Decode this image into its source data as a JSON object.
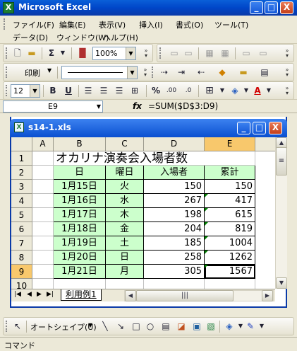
{
  "window": {
    "app_icon": "X",
    "title": "Microsoft Excel",
    "minimize": "_",
    "maximize": "□",
    "close": "X"
  },
  "menu": {
    "row1": [
      "ファイル(F)",
      "編集(E)",
      "表示(V)",
      "挿入(I)",
      "書式(O)",
      "ツール(T)"
    ],
    "row2": [
      "データ(D)",
      "ウィンドウ(W)",
      "ヘルプ(H)"
    ]
  },
  "toolbar_standard": {
    "zoom": "100%"
  },
  "toolbar_drawing_top": {
    "print_label": "印刷"
  },
  "toolbar_format": {
    "font_size": "12",
    "percent": "%",
    "bold": "B",
    "underline": "U"
  },
  "formula_bar": {
    "name_box": "E9",
    "fx": "fx",
    "formula": "=SUM($D$3:D9)"
  },
  "workbook": {
    "file_name": "s14-1.xls",
    "sheet_tab": "利用例1"
  },
  "columns": [
    "A",
    "B",
    "C",
    "D",
    "E"
  ],
  "rows": [
    "1",
    "2",
    "3",
    "4",
    "5",
    "6",
    "7",
    "8",
    "9",
    "10"
  ],
  "sheet": {
    "title": "オカリナ演奏会入場者数",
    "headers": [
      "日",
      "曜日",
      "入場者",
      "累計"
    ],
    "data": [
      [
        "1月15日",
        "火",
        "150",
        "150"
      ],
      [
        "1月16日",
        "水",
        "267",
        "417"
      ],
      [
        "1月17日",
        "木",
        "198",
        "615"
      ],
      [
        "1月18日",
        "金",
        "204",
        "819"
      ],
      [
        "1月19日",
        "土",
        "185",
        "1004"
      ],
      [
        "1月20日",
        "日",
        "258",
        "1262"
      ],
      [
        "1月21日",
        "月",
        "305",
        "1567"
      ]
    ]
  },
  "drawing_toolbar": {
    "autoshapes": "オートシェイプ(U)"
  },
  "status": {
    "text": "コマンド"
  },
  "colors": {
    "title_bar": "#0a4fd0",
    "green_fill": "#ccffcc",
    "selected_header": "#f8c86c"
  }
}
